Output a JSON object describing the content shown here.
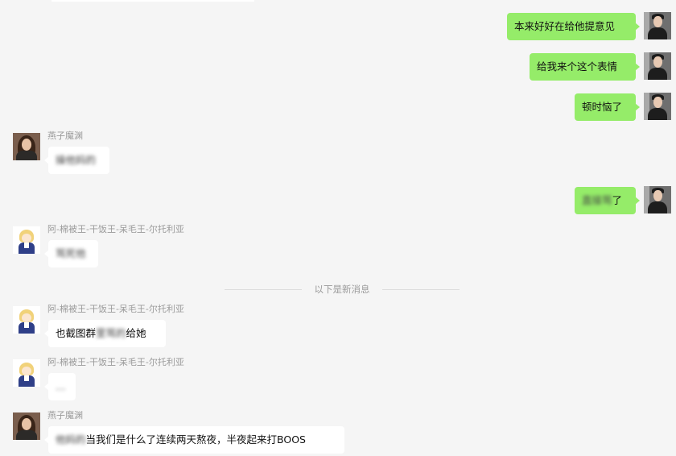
{
  "divider": {
    "label": "以下是新消息"
  },
  "messages": [
    {
      "side": "right",
      "sender": "me",
      "parts": [
        {
          "text": "本来好好在给他提意见",
          "blur": false
        }
      ]
    },
    {
      "side": "right",
      "sender": "me",
      "parts": [
        {
          "text": "给我来个这个表情",
          "blur": false
        }
      ]
    },
    {
      "side": "right",
      "sender": "me",
      "parts": [
        {
          "text": "顿时恼了",
          "blur": false
        }
      ]
    },
    {
      "side": "left",
      "sender": "燕子魔渊",
      "parts": [
        {
          "text": "操他妈的",
          "blur": true
        }
      ]
    },
    {
      "side": "right",
      "sender": "me",
      "parts": [
        {
          "text": "直接骂",
          "blur": true
        },
        {
          "text": "了",
          "blur": false
        }
      ]
    },
    {
      "side": "left",
      "sender": "阿-棉被王-干饭王-呆毛王-尔托利亚",
      "parts": [
        {
          "text": "骂死他",
          "blur": true
        }
      ]
    },
    {
      "side": "left",
      "sender": "阿-棉被王-干饭王-呆毛王-尔托利亚",
      "parts": [
        {
          "text": "也截图群",
          "blur": false
        },
        {
          "text": "里骂的",
          "blur": true
        },
        {
          "text": "给她",
          "blur": false
        }
      ]
    },
    {
      "side": "left",
      "sender": "阿-棉被王-干饭王-呆毛王-尔托利亚",
      "parts": [
        {
          "text": "…",
          "blur": true
        }
      ]
    },
    {
      "side": "left",
      "sender": "燕子魔渊",
      "parts": [
        {
          "text": "他妈的",
          "blur": true
        },
        {
          "text": "当我们是什么了连续两天熬夜，半夜起来打BOOS",
          "blur": false
        }
      ]
    }
  ]
}
